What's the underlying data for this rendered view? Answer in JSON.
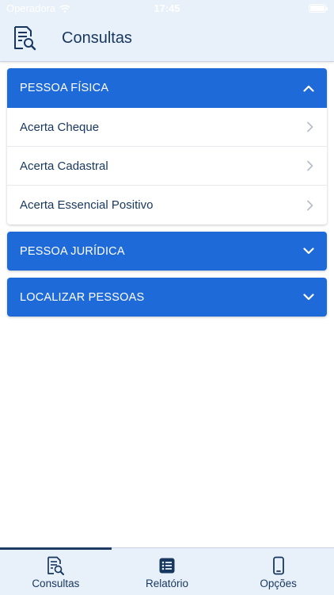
{
  "status_bar": {
    "carrier": "Operadora",
    "time": "17:45"
  },
  "header": {
    "title": "Consultas",
    "icon": "document-search-icon"
  },
  "sections": [
    {
      "label": "PESSOA FÍSICA",
      "expanded": true,
      "items": [
        {
          "label": "Acerta Cheque"
        },
        {
          "label": "Acerta Cadastral"
        },
        {
          "label": "Acerta Essencial Positivo"
        }
      ]
    },
    {
      "label": "PESSOA JURÍDICA",
      "expanded": false
    },
    {
      "label": "LOCALIZAR PESSOAS",
      "expanded": false
    }
  ],
  "tabbar": {
    "tabs": [
      {
        "label": "Consultas",
        "icon": "document-search-icon",
        "active": true
      },
      {
        "label": "Relatório",
        "icon": "list-icon",
        "active": false
      },
      {
        "label": "Opções",
        "icon": "phone-icon",
        "active": false
      }
    ]
  },
  "colors": {
    "primary": "#1f6ad9",
    "text": "#17375e",
    "bar_background": "#e8f0fa"
  }
}
